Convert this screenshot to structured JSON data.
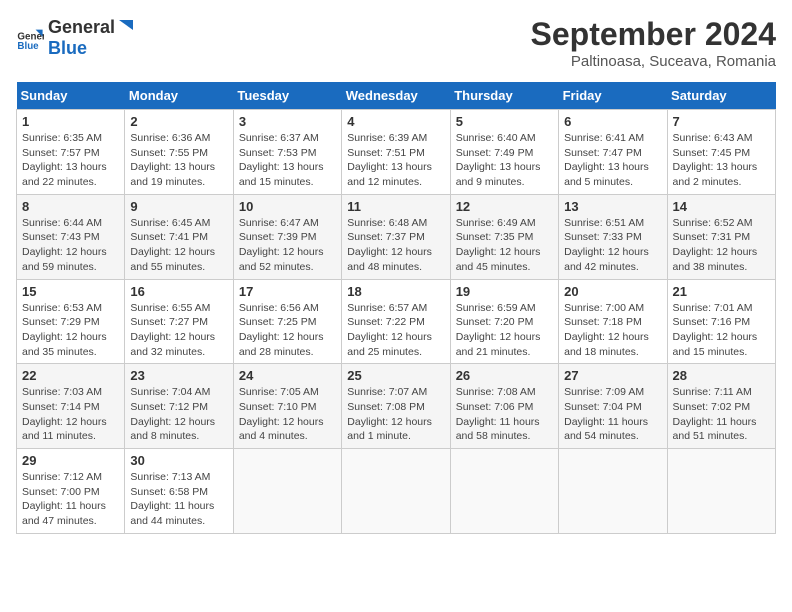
{
  "header": {
    "logo_general": "General",
    "logo_blue": "Blue",
    "month": "September 2024",
    "location": "Paltinoasa, Suceava, Romania"
  },
  "weekdays": [
    "Sunday",
    "Monday",
    "Tuesday",
    "Wednesday",
    "Thursday",
    "Friday",
    "Saturday"
  ],
  "weeks": [
    [
      {
        "day": "1",
        "info": "Sunrise: 6:35 AM\nSunset: 7:57 PM\nDaylight: 13 hours\nand 22 minutes."
      },
      {
        "day": "2",
        "info": "Sunrise: 6:36 AM\nSunset: 7:55 PM\nDaylight: 13 hours\nand 19 minutes."
      },
      {
        "day": "3",
        "info": "Sunrise: 6:37 AM\nSunset: 7:53 PM\nDaylight: 13 hours\nand 15 minutes."
      },
      {
        "day": "4",
        "info": "Sunrise: 6:39 AM\nSunset: 7:51 PM\nDaylight: 13 hours\nand 12 minutes."
      },
      {
        "day": "5",
        "info": "Sunrise: 6:40 AM\nSunset: 7:49 PM\nDaylight: 13 hours\nand 9 minutes."
      },
      {
        "day": "6",
        "info": "Sunrise: 6:41 AM\nSunset: 7:47 PM\nDaylight: 13 hours\nand 5 minutes."
      },
      {
        "day": "7",
        "info": "Sunrise: 6:43 AM\nSunset: 7:45 PM\nDaylight: 13 hours\nand 2 minutes."
      }
    ],
    [
      {
        "day": "8",
        "info": "Sunrise: 6:44 AM\nSunset: 7:43 PM\nDaylight: 12 hours\nand 59 minutes."
      },
      {
        "day": "9",
        "info": "Sunrise: 6:45 AM\nSunset: 7:41 PM\nDaylight: 12 hours\nand 55 minutes."
      },
      {
        "day": "10",
        "info": "Sunrise: 6:47 AM\nSunset: 7:39 PM\nDaylight: 12 hours\nand 52 minutes."
      },
      {
        "day": "11",
        "info": "Sunrise: 6:48 AM\nSunset: 7:37 PM\nDaylight: 12 hours\nand 48 minutes."
      },
      {
        "day": "12",
        "info": "Sunrise: 6:49 AM\nSunset: 7:35 PM\nDaylight: 12 hours\nand 45 minutes."
      },
      {
        "day": "13",
        "info": "Sunrise: 6:51 AM\nSunset: 7:33 PM\nDaylight: 12 hours\nand 42 minutes."
      },
      {
        "day": "14",
        "info": "Sunrise: 6:52 AM\nSunset: 7:31 PM\nDaylight: 12 hours\nand 38 minutes."
      }
    ],
    [
      {
        "day": "15",
        "info": "Sunrise: 6:53 AM\nSunset: 7:29 PM\nDaylight: 12 hours\nand 35 minutes."
      },
      {
        "day": "16",
        "info": "Sunrise: 6:55 AM\nSunset: 7:27 PM\nDaylight: 12 hours\nand 32 minutes."
      },
      {
        "day": "17",
        "info": "Sunrise: 6:56 AM\nSunset: 7:25 PM\nDaylight: 12 hours\nand 28 minutes."
      },
      {
        "day": "18",
        "info": "Sunrise: 6:57 AM\nSunset: 7:22 PM\nDaylight: 12 hours\nand 25 minutes."
      },
      {
        "day": "19",
        "info": "Sunrise: 6:59 AM\nSunset: 7:20 PM\nDaylight: 12 hours\nand 21 minutes."
      },
      {
        "day": "20",
        "info": "Sunrise: 7:00 AM\nSunset: 7:18 PM\nDaylight: 12 hours\nand 18 minutes."
      },
      {
        "day": "21",
        "info": "Sunrise: 7:01 AM\nSunset: 7:16 PM\nDaylight: 12 hours\nand 15 minutes."
      }
    ],
    [
      {
        "day": "22",
        "info": "Sunrise: 7:03 AM\nSunset: 7:14 PM\nDaylight: 12 hours\nand 11 minutes."
      },
      {
        "day": "23",
        "info": "Sunrise: 7:04 AM\nSunset: 7:12 PM\nDaylight: 12 hours\nand 8 minutes."
      },
      {
        "day": "24",
        "info": "Sunrise: 7:05 AM\nSunset: 7:10 PM\nDaylight: 12 hours\nand 4 minutes."
      },
      {
        "day": "25",
        "info": "Sunrise: 7:07 AM\nSunset: 7:08 PM\nDaylight: 12 hours\nand 1 minute."
      },
      {
        "day": "26",
        "info": "Sunrise: 7:08 AM\nSunset: 7:06 PM\nDaylight: 11 hours\nand 58 minutes."
      },
      {
        "day": "27",
        "info": "Sunrise: 7:09 AM\nSunset: 7:04 PM\nDaylight: 11 hours\nand 54 minutes."
      },
      {
        "day": "28",
        "info": "Sunrise: 7:11 AM\nSunset: 7:02 PM\nDaylight: 11 hours\nand 51 minutes."
      }
    ],
    [
      {
        "day": "29",
        "info": "Sunrise: 7:12 AM\nSunset: 7:00 PM\nDaylight: 11 hours\nand 47 minutes."
      },
      {
        "day": "30",
        "info": "Sunrise: 7:13 AM\nSunset: 6:58 PM\nDaylight: 11 hours\nand 44 minutes."
      },
      {
        "day": "",
        "info": ""
      },
      {
        "day": "",
        "info": ""
      },
      {
        "day": "",
        "info": ""
      },
      {
        "day": "",
        "info": ""
      },
      {
        "day": "",
        "info": ""
      }
    ]
  ]
}
